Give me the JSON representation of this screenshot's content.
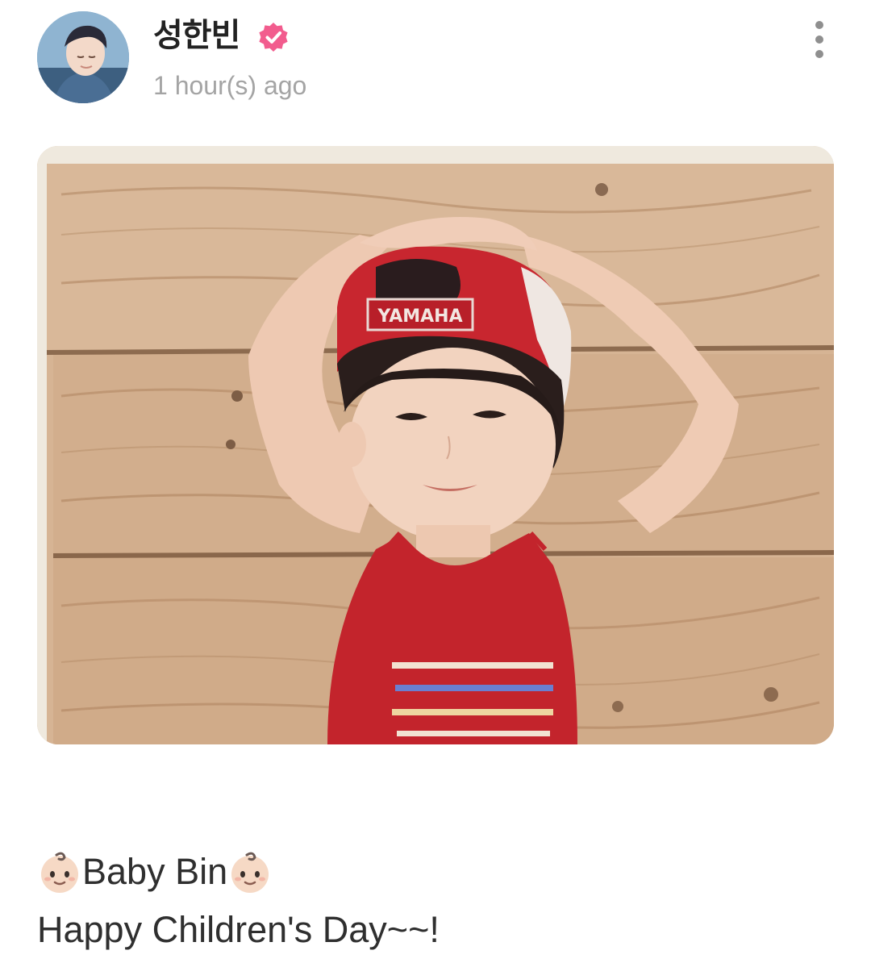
{
  "post": {
    "author": {
      "name": "성한빈",
      "verified": true,
      "avatar_icon": "profile-photo"
    },
    "timestamp": "1 hour(s) ago",
    "menu_icon": "more-vertical-icon",
    "media": {
      "type": "photo",
      "cap_text": "YAMAHA"
    },
    "caption": {
      "emoji": "👶🏻",
      "line1_text": "Baby Bin",
      "line2": "Happy Children's Day~~!"
    }
  },
  "colors": {
    "verified_badge": "#f25c8e",
    "timestamp": "#a4a4a4",
    "text": "#2f2f2f"
  }
}
